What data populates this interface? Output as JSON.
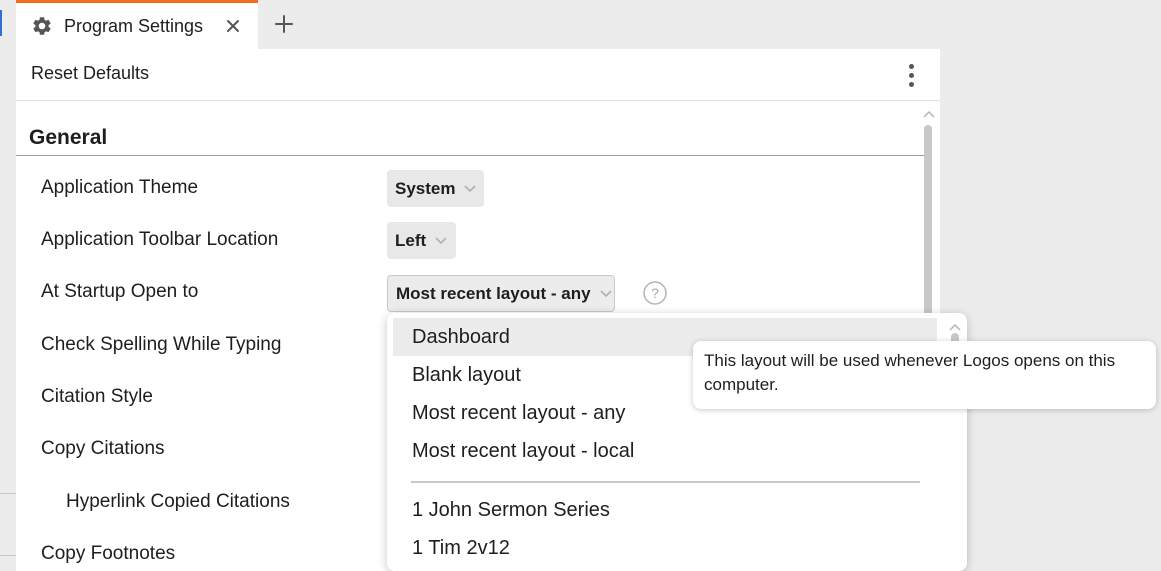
{
  "tab": {
    "title": "Program Settings",
    "icon": "gear-icon",
    "accent_color": "#f26b21"
  },
  "toolbar": {
    "reset_label": "Reset Defaults"
  },
  "section": {
    "title": "General"
  },
  "settings": [
    {
      "label": "Application Theme",
      "value": "System"
    },
    {
      "label": "Application Toolbar Location",
      "value": "Left"
    },
    {
      "label": "At Startup Open to",
      "value": "Most recent layout - any"
    },
    {
      "label": "Check Spelling While Typing"
    },
    {
      "label": "Citation Style"
    },
    {
      "label": "Copy Citations"
    },
    {
      "label": "Hyperlink Copied Citations"
    },
    {
      "label": "Copy Footnotes"
    }
  ],
  "dropdown": {
    "items": [
      "Dashboard",
      "Blank layout",
      "Most recent layout - any",
      "Most recent layout - local",
      "1 John Sermon Series",
      "1 Tim 2v12"
    ],
    "highlighted": "Dashboard"
  },
  "tooltip": {
    "text": "This layout will be used whenever Logos opens on this computer."
  }
}
